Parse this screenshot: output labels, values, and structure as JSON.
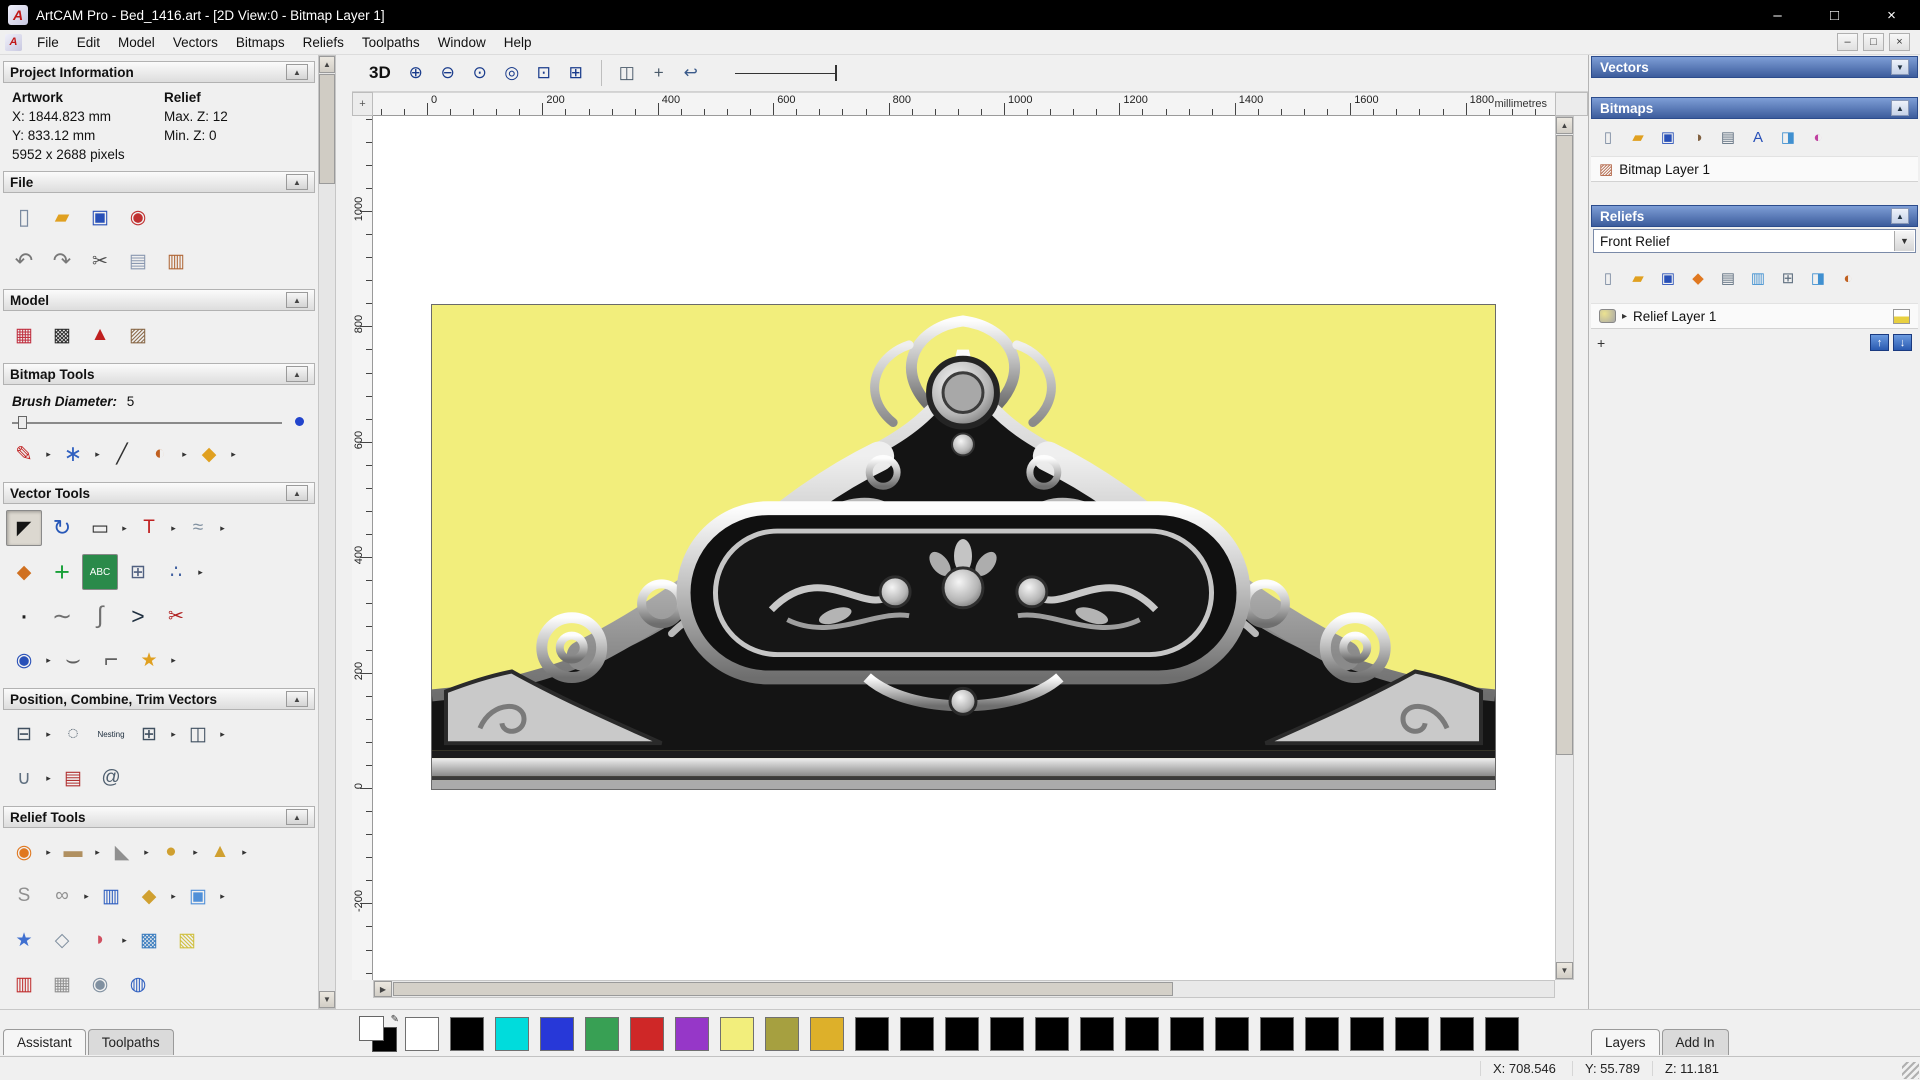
{
  "colors": {
    "title_bar": "#000000",
    "panel_gray": "#f0f0f0",
    "header_blue": "#3c5c9c",
    "canvas_yellow": "#f2ee7c",
    "accent_blue": "#2a5ab0"
  },
  "glyphs": {
    "logo": "A",
    "minimize": "–",
    "maximize": "□",
    "close": "×",
    "collapse": "▲",
    "dropdown": "▼",
    "flyout": "▸",
    "expand": "▸",
    "scroll_up": "▲",
    "scroll_down": "▼",
    "scroll_right": "▶",
    "up": "↑",
    "down": "↓",
    "plus": "+",
    "corner": "+",
    "pen": "✎"
  },
  "title_bar": {
    "title": "ArtCAM Pro - Bed_1416.art - [2D View:0 - Bitmap Layer 1]"
  },
  "menu_bar": {
    "items": [
      "File",
      "Edit",
      "Model",
      "Vectors",
      "Bitmaps",
      "Reliefs",
      "Toolpaths",
      "Window",
      "Help"
    ]
  },
  "toolbar": {
    "view_3d": "3D",
    "icons": [
      {
        "n": "zoom-in-icon",
        "g": "⊕",
        "c": "#1a3c8c"
      },
      {
        "n": "zoom-out-icon",
        "g": "⊖",
        "c": "#1a3c8c"
      },
      {
        "n": "zoom-object-icon",
        "g": "⊙",
        "c": "#1a3c8c"
      },
      {
        "n": "zoom-1to1-icon",
        "g": "◎",
        "c": "#1a3c8c"
      },
      {
        "n": "zoom-fit-icon",
        "g": "⊡",
        "c": "#1a3c8c"
      },
      {
        "n": "zoom-page-icon",
        "g": "⊞",
        "c": "#1a3c8c"
      },
      {
        "n": "toolbar-separator",
        "sep": true
      },
      {
        "n": "pan-view-icon",
        "g": "◫",
        "c": "#4a5a6a"
      },
      {
        "n": "snap-toggle-icon",
        "g": "+",
        "c": "#4a5a6a"
      },
      {
        "n": "previous-view-icon",
        "g": "↩",
        "c": "#3a5a8a"
      }
    ]
  },
  "left_panel": {
    "sections": {
      "project_information": "Project Information",
      "file": "File",
      "model": "Model",
      "bitmap_tools": "Bitmap Tools",
      "vector_tools": "Vector Tools",
      "position": "Position, Combine, Trim Vectors",
      "relief_tools": "Relief Tools"
    },
    "project_info": {
      "col1": "Artwork",
      "col2": "Relief",
      "x": "X: 1844.823 mm",
      "max_z": "Max. Z: 12",
      "y": "Y: 833.12 mm",
      "min_z": "Min. Z: 0",
      "pixels": "5952 x 2688 pixels"
    },
    "brush_diameter_label": "Brush Diameter:",
    "brush_diameter_value": "5",
    "file_icons_1": [
      {
        "n": "new-model-icon",
        "g": "▯",
        "c": "#7a8aa0",
        "fs": 22
      },
      {
        "n": "open-model-icon",
        "g": "▰",
        "c": "#e0a020"
      },
      {
        "n": "save-model-icon",
        "g": "▣",
        "c": "#2850b8"
      },
      {
        "n": "import-model-icon",
        "g": "◉",
        "c": "#c03030"
      }
    ],
    "file_icons_2": [
      {
        "n": "undo-icon",
        "g": "↶",
        "c": "#787878",
        "fs": 22
      },
      {
        "n": "redo-icon",
        "g": "↷",
        "c": "#787878",
        "fs": 22
      },
      {
        "n": "cut-icon",
        "g": "✂",
        "c": "#505050"
      },
      {
        "n": "copy-icon",
        "g": "▤",
        "c": "#8a98b0"
      },
      {
        "n": "paste-icon",
        "g": "▥",
        "c": "#b06838"
      }
    ],
    "model_icons": [
      {
        "n": "set-model-size-icon",
        "g": "▦",
        "c": "#c03040"
      },
      {
        "n": "adjust-model-icon",
        "g": "▩",
        "c": "#303030"
      },
      {
        "n": "set-lighting-icon",
        "g": "▲",
        "c": "#c02020"
      },
      {
        "n": "load-relief-icon",
        "g": "▨",
        "c": "#8a6a4a"
      }
    ],
    "bitmap_tool_icons": [
      {
        "n": "paint-icon",
        "g": "✎",
        "c": "#c02020",
        "fs": 21,
        "dd": true
      },
      {
        "n": "paint-selective-icon",
        "g": "∗",
        "c": "#3060c0",
        "fs": 22,
        "dd": true
      },
      {
        "n": "colour-picker-icon",
        "g": "╱",
        "c": "#303030"
      },
      {
        "n": "palette-icon",
        "g": "◐",
        "c": "#c06020",
        "dd": true
      },
      {
        "n": "flood-fill-icon",
        "g": "◆",
        "c": "#e0a020",
        "dd": true
      }
    ],
    "vector_icons_1": [
      {
        "n": "select-vectors-icon",
        "g": "◤",
        "c": "#151515",
        "sel": true
      },
      {
        "n": "transform-vectors-icon",
        "g": "↻",
        "c": "#2858b8",
        "fs": 22
      },
      {
        "n": "create-rectangle-icon",
        "g": "▭",
        "c": "#303030",
        "dd": true
      },
      {
        "n": "create-text-icon",
        "g": "T",
        "c": "#c02020",
        "dd": true
      },
      {
        "n": "measure-icon",
        "g": "≈",
        "c": "#8090a0",
        "dd": true
      }
    ],
    "vector_icons_2": [
      {
        "n": "vector-doctor-icon",
        "g": "◆",
        "c": "#d07020"
      },
      {
        "n": "node-editing-icon",
        "g": "+",
        "c": "#18a038",
        "fs": 27
      },
      {
        "n": "text-on-curve-icon",
        "g": "ABC",
        "c": "#ffffff",
        "b": "#2a8a4a",
        "fs": 10
      },
      {
        "n": "make-grid-icon",
        "g": "⊞",
        "c": "#506080"
      },
      {
        "n": "paste-along-curve-icon",
        "g": "∴",
        "c": "#4060a0",
        "dd": true
      }
    ],
    "vector_icons_3": [
      {
        "n": "create-point-icon",
        "g": "·",
        "c": "#202020",
        "fs": 30
      },
      {
        "n": "create-freehand-icon",
        "g": "∼",
        "c": "#707070",
        "fs": 24
      },
      {
        "n": "create-bezier-icon",
        "g": "∫",
        "c": "#707070",
        "fs": 24
      },
      {
        "n": "create-polyline-icon",
        "g": ">",
        "c": "#203040",
        "fs": 23
      },
      {
        "n": "cut-vectors-icon",
        "g": "✂",
        "c": "#b02020"
      }
    ],
    "vector_icons_4": [
      {
        "n": "create-circle-icon",
        "g": "◉",
        "c": "#2850b8",
        "dd": true
      },
      {
        "n": "create-arc-icon",
        "g": "⌣",
        "c": "#606060",
        "fs": 24
      },
      {
        "n": "fillet-icon",
        "g": "⌐",
        "c": "#606060",
        "fs": 24
      },
      {
        "n": "create-star-icon",
        "g": "★",
        "c": "#e0a020",
        "dd": true
      }
    ],
    "position_icons_1": [
      {
        "n": "align-objects-icon",
        "g": "⊟",
        "c": "#405060",
        "dd": true
      },
      {
        "n": "circular-copy-icon",
        "g": "◌",
        "c": "#405060"
      },
      {
        "n": "nesting-icon",
        "g": "Nesting",
        "c": "#203040",
        "fs": 8
      },
      {
        "n": "block-copy-icon",
        "g": "⊞",
        "c": "#405060",
        "dd": true
      },
      {
        "n": "rotate-copy-icon",
        "g": "◫",
        "c": "#405060",
        "dd": true
      }
    ],
    "position_icons_2": [
      {
        "n": "mirror-vectors-icon",
        "g": "∪",
        "c": "#607080",
        "dd": true
      },
      {
        "n": "weave-vectors-icon",
        "g": "▤",
        "c": "#b03030"
      },
      {
        "n": "wrap-vectors-icon",
        "g": "@",
        "c": "#506070"
      }
    ],
    "relief_icons_1": [
      {
        "n": "shape-editor-icon",
        "g": "◉",
        "c": "#e07820",
        "dd": true
      },
      {
        "n": "smooth-relief-icon",
        "g": "▬",
        "c": "#b09060",
        "dd": true
      },
      {
        "n": "sculpt-icon",
        "g": "◣",
        "c": "#909090",
        "dd": true
      },
      {
        "n": "add-clay-icon",
        "g": "●",
        "c": "#d0a030",
        "dd": true
      },
      {
        "n": "texture-relief-icon",
        "g": "▲",
        "c": "#d0a030",
        "dd": true
      }
    ],
    "relief_icons_2": [
      {
        "n": "smart-engrave-icon",
        "g": "S",
        "c": "#909090"
      },
      {
        "n": "weave-relief-icon",
        "g": "∞",
        "c": "#909090",
        "dd": true
      },
      {
        "n": "two-rail-sweep-icon",
        "g": "▥",
        "c": "#3060c0"
      },
      {
        "n": "extrude-icon",
        "g": "◆",
        "c": "#d0a030",
        "dd": true
      },
      {
        "n": "turn-icon",
        "g": "▣",
        "c": "#5090d8",
        "dd": true
      }
    ],
    "relief_icons_3": [
      {
        "n": "star-relief-icon",
        "g": "★",
        "c": "#4070d0"
      },
      {
        "n": "unwrap-relief-icon",
        "g": "◇",
        "c": "#8090a0"
      },
      {
        "n": "fan-relief-icon",
        "g": "◗",
        "c": "#d05060",
        "dd": true
      },
      {
        "n": "texture-flow-icon",
        "g": "▩",
        "c": "#4080c0"
      },
      {
        "n": "offset-relief-icon",
        "g": "▧",
        "c": "#d0c040"
      }
    ],
    "relief_icons_4": [
      {
        "n": "relief-tool-icon",
        "g": "▥",
        "c": "#c03030"
      },
      {
        "n": "relief-tool-icon",
        "g": "▦",
        "c": "#909090"
      },
      {
        "n": "relief-tool-icon",
        "g": "◉",
        "c": "#8090a0"
      },
      {
        "n": "relief-tool-icon",
        "g": "◍",
        "c": "#3060c0"
      }
    ],
    "tabs": [
      {
        "label": "Assistant",
        "active": true
      },
      {
        "label": "Toolpaths",
        "active": false
      }
    ]
  },
  "rulers": {
    "unit": "millimetres",
    "h_ticks": [
      "0",
      "200",
      "400",
      "600",
      "800",
      "1000",
      "1200",
      "1400",
      "1600",
      "1800"
    ],
    "v_ticks": [
      "1000",
      "800",
      "600",
      "400",
      "200",
      "0",
      "-200"
    ]
  },
  "right_panel": {
    "vectors_header": "Vectors",
    "bitmaps_header": "Bitmaps",
    "bitmap_layer": "Bitmap Layer 1",
    "bitmap_layer_icon": "▨",
    "reliefs_header": "Reliefs",
    "relief_combo": "Front Relief",
    "relief_layer": "Relief Layer 1",
    "bitmaps_icons": [
      {
        "n": "new-bitmap-icon",
        "g": "▯",
        "c": "#7a8aa0"
      },
      {
        "n": "open-bitmap-icon",
        "g": "▰",
        "c": "#e0a020"
      },
      {
        "n": "save-bitmap-icon",
        "g": "▣",
        "c": "#2850b8"
      },
      {
        "n": "bitmap-contrast-icon",
        "g": "◑",
        "c": "#806040"
      },
      {
        "n": "greyscale-icon",
        "g": "▤",
        "c": "#607080"
      },
      {
        "n": "bitmap-text-icon",
        "g": "A",
        "c": "#2850b8"
      },
      {
        "n": "clear-bitmap-icon",
        "g": "◨",
        "c": "#4090d0"
      },
      {
        "n": "bitmap-colours-icon",
        "g": "◐",
        "c": "#c040a0"
      }
    ],
    "reliefs_icons": [
      {
        "n": "new-relief-icon",
        "g": "▯",
        "c": "#7a8aa0"
      },
      {
        "n": "open-relief-icon",
        "g": "▰",
        "c": "#e0a020"
      },
      {
        "n": "save-relief-icon",
        "g": "▣",
        "c": "#2850b8"
      },
      {
        "n": "calculate-relief-icon",
        "g": "◆",
        "c": "#e07820"
      },
      {
        "n": "relief-preview-icon",
        "g": "▤",
        "c": "#607080"
      },
      {
        "n": "relief-page-icon",
        "g": "▥",
        "c": "#4090d0"
      },
      {
        "n": "transfer-relief-icon",
        "g": "⊞",
        "c": "#607080"
      },
      {
        "n": "delete-relief-icon",
        "g": "◨",
        "c": "#4090d0"
      },
      {
        "n": "relief-colours-icon",
        "g": "◐",
        "c": "#c06020"
      }
    ],
    "tabs": [
      {
        "label": "Layers",
        "active": true
      },
      {
        "label": "Add In",
        "active": false
      }
    ]
  },
  "palette": {
    "swatches": [
      "#ffffff",
      "#000000",
      "#00dcdc",
      "#2738d8",
      "#38a054",
      "#cf2727",
      "#9637c8",
      "#f2ee7c",
      "#a6a040",
      "#ddb02a",
      "#000000",
      "#000000",
      "#000000",
      "#000000",
      "#000000",
      "#000000",
      "#000000",
      "#000000",
      "#000000",
      "#000000",
      "#000000",
      "#000000",
      "#000000",
      "#000000",
      "#000000"
    ]
  },
  "status_bar": {
    "x": "X: 708.546",
    "y": "Y: 55.789",
    "z": "Z: 11.181"
  }
}
